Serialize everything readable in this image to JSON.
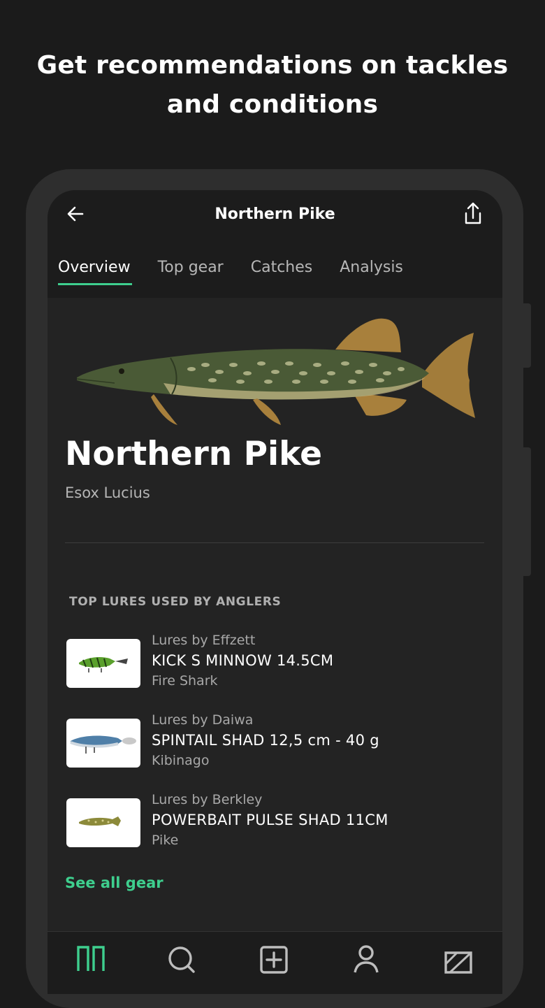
{
  "headline": {
    "line1": "Get recommendations on tackles",
    "line2": "and conditions"
  },
  "appbar": {
    "title": "Northern Pike",
    "back_icon": "arrow-left-icon",
    "share_icon": "share-icon"
  },
  "tabs": [
    {
      "label": "Overview",
      "active": true
    },
    {
      "label": "Top gear",
      "active": false
    },
    {
      "label": "Catches",
      "active": false
    },
    {
      "label": "Analysis",
      "active": false
    }
  ],
  "species": {
    "name": "Northern Pike",
    "latin": "Esox Lucius"
  },
  "top_lures": {
    "section_label": "TOP LURES USED BY ANGLERS",
    "items": [
      {
        "brand": "Lures by Effzett",
        "name": "KICK S MINNOW 14.5CM",
        "color": "Fire Shark"
      },
      {
        "brand": "Lures by Daiwa",
        "name": "SPINTAIL SHAD 12,5 cm - 40 g",
        "color": "Kibinago"
      },
      {
        "brand": "Lures by Berkley",
        "name": "POWERBAIT PULSE SHAD 11CM",
        "color": "Pike"
      }
    ],
    "see_all": "See all gear"
  },
  "bottom_nav": [
    {
      "icon": "feed-icon",
      "active": true
    },
    {
      "icon": "search-icon",
      "active": false
    },
    {
      "icon": "add-catch-icon",
      "active": false
    },
    {
      "icon": "profile-icon",
      "active": false
    },
    {
      "icon": "map-icon",
      "active": false
    }
  ],
  "colors": {
    "accent": "#3ecf8e",
    "background": "#1b1b1b",
    "surface": "#232323"
  }
}
